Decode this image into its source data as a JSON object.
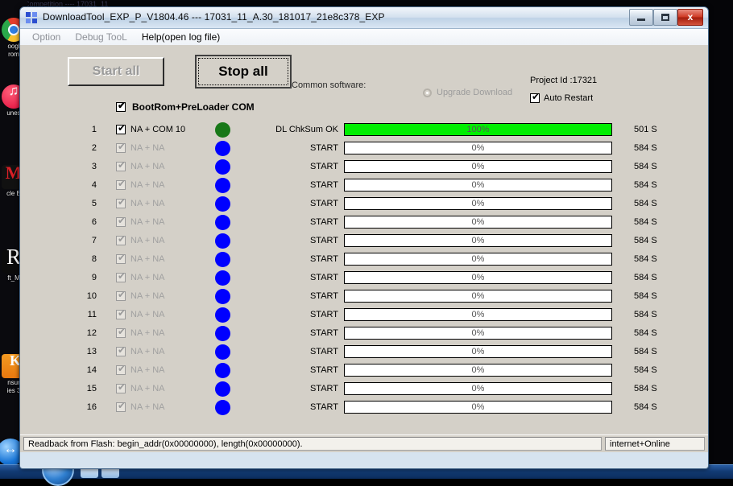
{
  "desktop": {
    "icons": [
      {
        "name": "chrome",
        "label": "oogle\nrom",
        "label1": "oogl",
        "label2": "rom"
      },
      {
        "name": "itunes",
        "label1": "unes",
        "label2": ""
      },
      {
        "name": "muscle-box",
        "label1": "cle B",
        "label2": ""
      },
      {
        "name": "soft-m",
        "label1": "ft_M",
        "label2": ""
      },
      {
        "name": "insurance",
        "label1": "nsur",
        "label2": "ies 3"
      }
    ],
    "background_window_title": "Competition ---- 17031_11"
  },
  "window": {
    "title": "DownloadTool_EXP_P_V1804.46 --- 17031_11_A.30_181017_21e8c378_EXP",
    "minimize_label": "",
    "maximize_label": "",
    "close_label": "x"
  },
  "menu": [
    {
      "label": "Option",
      "enabled": false
    },
    {
      "label": "Debug TooL",
      "enabled": false
    },
    {
      "label": "Help(open log file)",
      "enabled": true
    }
  ],
  "toolbar": {
    "start_all_label": "Start all",
    "stop_all_label": "Stop all",
    "common_software_label": "Common software:",
    "upgrade_download_label": "Upgrade Download",
    "project_id_label": "Project Id :17321",
    "auto_restart_label": "Auto Restart",
    "auto_restart_checked": true
  },
  "group": {
    "bootrom_label": "BootRom+PreLoader COM",
    "bootrom_checked": true
  },
  "colors": {
    "progress_green": "#00ee00",
    "led_active": "#187818",
    "led_idle": "#0000ff",
    "window_face": "#d4d0c8"
  },
  "rows": [
    {
      "num": "1",
      "port": "NA + COM 10",
      "checked": true,
      "enabled": true,
      "led": "green",
      "state": "DL ChkSum OK",
      "percent": 100,
      "percent_label": "100%",
      "time": "501 S"
    },
    {
      "num": "2",
      "port": "NA + NA",
      "checked": true,
      "enabled": false,
      "led": "blue",
      "state": "START",
      "percent": 0,
      "percent_label": "0%",
      "time": "584 S"
    },
    {
      "num": "3",
      "port": "NA + NA",
      "checked": true,
      "enabled": false,
      "led": "blue",
      "state": "START",
      "percent": 0,
      "percent_label": "0%",
      "time": "584 S"
    },
    {
      "num": "4",
      "port": "NA + NA",
      "checked": true,
      "enabled": false,
      "led": "blue",
      "state": "START",
      "percent": 0,
      "percent_label": "0%",
      "time": "584 S"
    },
    {
      "num": "5",
      "port": "NA + NA",
      "checked": true,
      "enabled": false,
      "led": "blue",
      "state": "START",
      "percent": 0,
      "percent_label": "0%",
      "time": "584 S"
    },
    {
      "num": "6",
      "port": "NA + NA",
      "checked": true,
      "enabled": false,
      "led": "blue",
      "state": "START",
      "percent": 0,
      "percent_label": "0%",
      "time": "584 S"
    },
    {
      "num": "7",
      "port": "NA + NA",
      "checked": true,
      "enabled": false,
      "led": "blue",
      "state": "START",
      "percent": 0,
      "percent_label": "0%",
      "time": "584 S"
    },
    {
      "num": "8",
      "port": "NA + NA",
      "checked": true,
      "enabled": false,
      "led": "blue",
      "state": "START",
      "percent": 0,
      "percent_label": "0%",
      "time": "584 S"
    },
    {
      "num": "9",
      "port": "NA + NA",
      "checked": true,
      "enabled": false,
      "led": "blue",
      "state": "START",
      "percent": 0,
      "percent_label": "0%",
      "time": "584 S"
    },
    {
      "num": "10",
      "port": "NA + NA",
      "checked": true,
      "enabled": false,
      "led": "blue",
      "state": "START",
      "percent": 0,
      "percent_label": "0%",
      "time": "584 S"
    },
    {
      "num": "11",
      "port": "NA + NA",
      "checked": true,
      "enabled": false,
      "led": "blue",
      "state": "START",
      "percent": 0,
      "percent_label": "0%",
      "time": "584 S"
    },
    {
      "num": "12",
      "port": "NA + NA",
      "checked": true,
      "enabled": false,
      "led": "blue",
      "state": "START",
      "percent": 0,
      "percent_label": "0%",
      "time": "584 S"
    },
    {
      "num": "13",
      "port": "NA + NA",
      "checked": true,
      "enabled": false,
      "led": "blue",
      "state": "START",
      "percent": 0,
      "percent_label": "0%",
      "time": "584 S"
    },
    {
      "num": "14",
      "port": "NA + NA",
      "checked": true,
      "enabled": false,
      "led": "blue",
      "state": "START",
      "percent": 0,
      "percent_label": "0%",
      "time": "584 S"
    },
    {
      "num": "15",
      "port": "NA + NA",
      "checked": true,
      "enabled": false,
      "led": "blue",
      "state": "START",
      "percent": 0,
      "percent_label": "0%",
      "time": "584 S"
    },
    {
      "num": "16",
      "port": "NA + NA",
      "checked": true,
      "enabled": false,
      "led": "blue",
      "state": "START",
      "percent": 0,
      "percent_label": "0%",
      "time": "584 S"
    }
  ],
  "statusbar": {
    "message": "Readback from Flash:  begin_addr(0x00000000), length(0x00000000).",
    "connection": "internet+Online"
  }
}
